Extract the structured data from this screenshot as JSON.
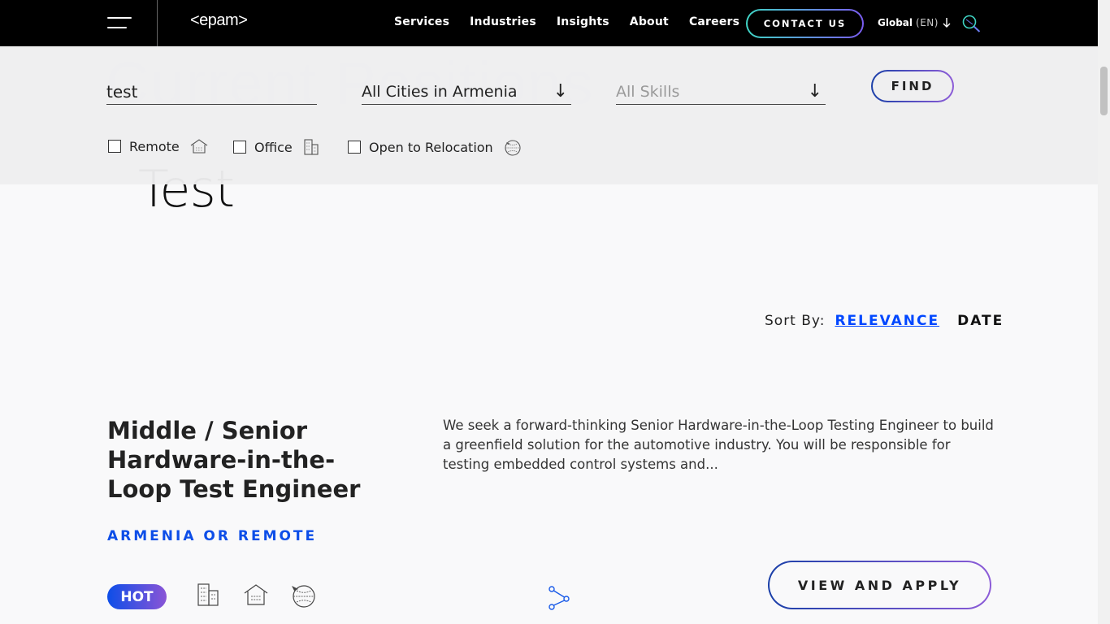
{
  "header": {
    "logo": "<epam>",
    "nav": [
      "Services",
      "Industries",
      "Insights",
      "About",
      "Careers"
    ],
    "contact_label": "CONTACT US",
    "region": "Global",
    "lang": "(EN)"
  },
  "search": {
    "keyword_value": "test",
    "city_value": "All Cities in Armenia",
    "skills_placeholder": "All Skills",
    "find_label": "FIND",
    "filters": [
      "Remote",
      "Office",
      "Open to Relocation"
    ]
  },
  "results": {
    "query_heading": "Test",
    "sort_label": "Sort By:",
    "sort_relevance": "RELEVANCE",
    "sort_date": "DATE"
  },
  "job": {
    "title": "Middle / Senior Hardware-in-the-Loop Test Engineer",
    "location": "ARMENIA OR REMOTE",
    "description": "We seek a forward-thinking Senior Hardware-in-the-Loop Testing Engineer to build a greenfield solution for the automotive industry. You will be responsible for testing embedded control systems and...",
    "hot_label": "HOT",
    "apply_label": "VIEW AND APPLY",
    "icons": [
      "office-icon",
      "remote-icon",
      "relocation-icon",
      "share-icon"
    ]
  }
}
